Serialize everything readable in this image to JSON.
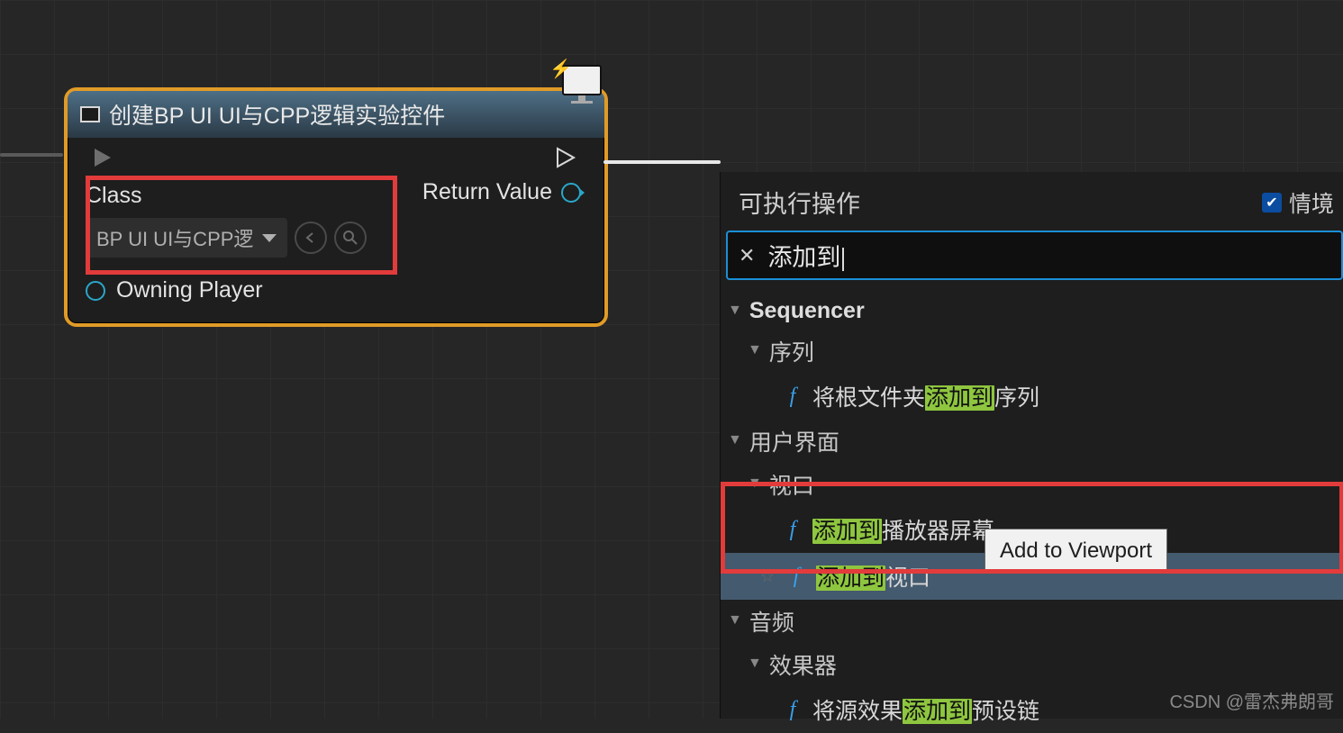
{
  "node": {
    "title": "创建BP UI UI与CPP逻辑实验控件",
    "class_label": "Class",
    "class_value": "BP UI UI与CPP逻",
    "return_label": "Return Value",
    "owning_label": "Owning Player"
  },
  "panel": {
    "header": "可执行操作",
    "context_label": "情境",
    "search_value": "添加到",
    "categories": {
      "sequencer": "Sequencer",
      "sequence_sub": "序列",
      "sequence_item_pre": "将根文件夹",
      "sequence_item_hl": "添加到",
      "sequence_item_post": "序列",
      "ui": "用户界面",
      "viewport_sub": "视口",
      "item1_hl": "添加到",
      "item1_post": "播放器屏幕",
      "item2_hl": "添加到",
      "item2_post": "视口",
      "audio": "音频",
      "fx_sub": "效果器",
      "fx_item_pre": "将源效果",
      "fx_item_hl": "添加到",
      "fx_item_post": "预设链"
    },
    "tooltip": "Add to Viewport"
  },
  "watermark": "CSDN @雷杰弗朗哥"
}
